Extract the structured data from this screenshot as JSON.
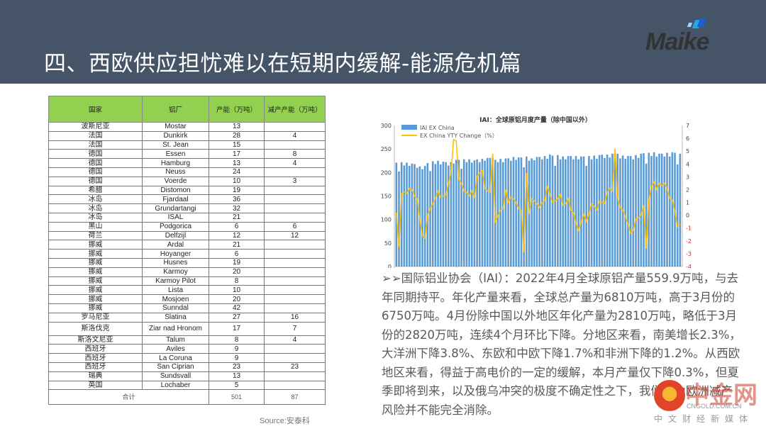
{
  "header": {
    "title": "四、西欧供应担忧难以在短期内缓解-能源危机篇",
    "logo_text": "Maike"
  },
  "table": {
    "columns": [
      "国家",
      "铝厂",
      "产能（万吨）",
      "减产产能（万吨）"
    ],
    "rows": [
      [
        "波斯尼亚",
        "Mostar",
        "13",
        ""
      ],
      [
        "法国",
        "Dunkirk",
        "28",
        "4"
      ],
      [
        "法国",
        "St. Jean",
        "15",
        ""
      ],
      [
        "德国",
        "Essen",
        "17",
        "8"
      ],
      [
        "德国",
        "Hamburg",
        "13",
        "4"
      ],
      [
        "德国",
        "Neuss",
        "24",
        ""
      ],
      [
        "德国",
        "Voerde",
        "10",
        "3"
      ],
      [
        "希腊",
        "Distomon",
        "19",
        ""
      ],
      [
        "冰岛",
        "Fjardaal",
        "36",
        ""
      ],
      [
        "冰岛",
        "Grundartangi",
        "32",
        ""
      ],
      [
        "冰岛",
        "ISAL",
        "21",
        ""
      ],
      [
        "黑山",
        "Podgorica",
        "6",
        "6"
      ],
      [
        "荷兰",
        "Delfzijl",
        "12",
        "12"
      ],
      [
        "挪威",
        "Ardal",
        "21",
        ""
      ],
      [
        "挪威",
        "Hoyanger",
        "6",
        ""
      ],
      [
        "挪威",
        "Husnes",
        "19",
        ""
      ],
      [
        "挪威",
        "Karmoy",
        "20",
        ""
      ],
      [
        "挪威",
        "Karmoy Pilot",
        "8",
        ""
      ],
      [
        "挪威",
        "Lista",
        "10",
        ""
      ],
      [
        "挪威",
        "Mosjoen",
        "20",
        ""
      ],
      [
        "挪威",
        "Sunndal",
        "42",
        ""
      ],
      [
        "罗马尼亚",
        "Slatina",
        "27",
        "16"
      ],
      [
        "斯洛伐克",
        "Ziar nad Hronom",
        "17",
        "7"
      ],
      [
        "斯洛文尼亚",
        "Talum",
        "8",
        "4"
      ],
      [
        "西班牙",
        "Aviles",
        "9",
        ""
      ],
      [
        "西班牙",
        "La Coruna",
        "9",
        ""
      ],
      [
        "西班牙",
        "San Ciprian",
        "23",
        "23"
      ],
      [
        "瑞典",
        "Sundsvall",
        "13",
        ""
      ],
      [
        "英国",
        "Lochaber",
        "5",
        ""
      ]
    ],
    "total": {
      "label": "合计",
      "capacity": "501",
      "cut": "87"
    },
    "header_color": "#92d050"
  },
  "source": "Source:安泰科",
  "chart_data": {
    "type": "bar+line",
    "title": "IAI：全球原铝月度产量（除中国以外）",
    "x_start": "2013/01",
    "x_ticks": [
      "2013/01",
      "2015/01",
      "2017/01",
      "2019/01",
      "2021/01"
    ],
    "y_left": {
      "range": [
        0,
        300
      ],
      "ticks": [
        0,
        50,
        100,
        150,
        200,
        250,
        300
      ]
    },
    "y_right": {
      "range": [
        -4,
        7
      ],
      "ticks": [
        7,
        6,
        5,
        4,
        3,
        2,
        1,
        0,
        -1,
        -2,
        -3,
        -4
      ],
      "negative_color": "#e02020"
    },
    "legend_placement": "top-left",
    "series": [
      {
        "name": "IAI EX China",
        "type": "bar",
        "axis": "left",
        "color": "#5b9bd5",
        "values": [
          221,
          202,
          222,
          215,
          221,
          214,
          219,
          218,
          210,
          213,
          207,
          214,
          220,
          203,
          224,
          218,
          225,
          217,
          223,
          222,
          215,
          222,
          219,
          227,
          227,
          208,
          228,
          222,
          228,
          221,
          226,
          228,
          222,
          229,
          225,
          231,
          231,
          231,
          227,
          222,
          229,
          222,
          230,
          230,
          225,
          233,
          227,
          232,
          232,
          211,
          234,
          225,
          230,
          226,
          233,
          233,
          228,
          235,
          229,
          238,
          236,
          214,
          237,
          228,
          234,
          228,
          235,
          235,
          228,
          235,
          228,
          234,
          234,
          214,
          235,
          228,
          236,
          229,
          237,
          238,
          231,
          238,
          232,
          240,
          240,
          240,
          230,
          236,
          229,
          235,
          235,
          228,
          237,
          231,
          240,
          241,
          219,
          242,
          235,
          243,
          234,
          240,
          240,
          234,
          242,
          234,
          243,
          242,
          217,
          240
        ]
      },
      {
        "name": "EX China YTY Change（%）",
        "type": "line",
        "axis": "right",
        "color": "#ffc000",
        "values": [
          0.2,
          -2.5,
          1.7,
          1.8,
          1.7,
          2.1,
          2.0,
          1.5,
          1.3,
          -0.3,
          -1.6,
          -1.8,
          0.0,
          0.5,
          0.9,
          1.3,
          1.9,
          1.4,
          1.5,
          1.6,
          2.5,
          3.3,
          5.9,
          5.8,
          2.8,
          2.5,
          1.9,
          1.8,
          1.5,
          1.9,
          1.4,
          3.0,
          3.3,
          3.5,
          2.1,
          1.9,
          1.8,
          4.8,
          -0.5,
          -0.1,
          0.4,
          0.5,
          2.0,
          1.0,
          1.4,
          1.3,
          1.0,
          0.5,
          0.4,
          -2.9,
          3.3,
          0.1,
          1.3,
          1.1,
          0.9,
          0.6,
          1.0,
          1.1,
          2.3,
          1.6,
          1.0,
          1.1,
          1.3,
          1.6,
          0.8,
          0.9,
          1.3,
          0.4,
          0.2,
          -0.6,
          -1.2,
          -0.5,
          0.1,
          -0.5,
          0.1,
          0.9,
          0.7,
          0.4,
          1.1,
          1.0,
          0.9,
          1.8,
          2.1,
          1.9,
          5.2,
          1.4,
          0.6,
          0.4,
          -0.1,
          -0.7,
          -1.4,
          -1.2,
          -0.3,
          -0.2,
          0.0,
          0.8,
          -2.6,
          1.2,
          2.2,
          2.6,
          2.0,
          2.5,
          2.3,
          2.5,
          2.1,
          1.3,
          1.2,
          0.3,
          -0.9,
          -0.7
        ]
      }
    ]
  },
  "paragraph": "➢➢国际铝业协会（IAI）：2022年4月全球原铝产量559.9万吨，与去年同期持平。年化产量来看，全球总产量为6810万吨，高于3月份的6750万吨。4月份除中国以外地区年化产量为2810万吨，略低于3月份的2820万吨，连续4个月环比下降。分地区来看，南美增长2.3%，大洋洲下降3.8%、东欧和中欧下降1.7%和非洲下降的1.2%。从西欧地区来看，得益于高电价的一定的缓解，本月产量仅下降0.3%，但夏季即将到来，以及俄乌冲突的极度不确定性之下，我们认为欧洲减产风险并不能完全消除。",
  "watermark": {
    "name": "中金网",
    "domain": "CNGOLD.COM.CN",
    "tagline": "中文财经新媒体"
  }
}
